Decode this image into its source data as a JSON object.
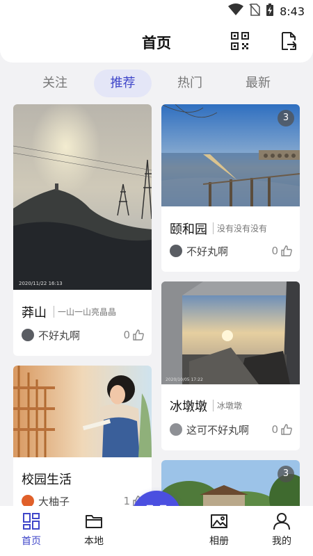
{
  "status_bar": {
    "time": "8:43",
    "icons": [
      "wifi-icon",
      "no-sim-icon",
      "battery-charging-icon"
    ]
  },
  "header": {
    "title": "首页",
    "icons": [
      "qr-code-icon",
      "share-export-icon"
    ]
  },
  "tabs": [
    {
      "label": "关注",
      "active": false
    },
    {
      "label": "推荐",
      "active": true
    },
    {
      "label": "热门",
      "active": false
    },
    {
      "label": "最新",
      "active": false
    }
  ],
  "cards": [
    {
      "title": "莽山",
      "subtitle": "一山一山亮晶晶",
      "author": "不好丸啊",
      "likes": "0",
      "photo_stamp": "2020/11/22 16:13"
    },
    {
      "title": "颐和园",
      "subtitle": "没有没有没有",
      "author": "不好丸啊",
      "likes": "0",
      "badge": "3"
    },
    {
      "title": "冰墩墩",
      "subtitle": "冰墩墩",
      "author": "这可不好丸啊",
      "likes": "0",
      "photo_stamp": "2020/10/05 17:22"
    },
    {
      "title": "校园生活",
      "subtitle": "",
      "author": "大柚子",
      "likes": "1"
    },
    {
      "title": "",
      "subtitle": "",
      "author": "",
      "likes": "",
      "badge": "3"
    }
  ],
  "bottom_nav": [
    {
      "label": "首页",
      "icon": "home-grid-icon",
      "active": true
    },
    {
      "label": "本地",
      "icon": "folder-icon",
      "active": false
    },
    {
      "label": "",
      "icon": "scan-icon",
      "active": false
    },
    {
      "label": "相册",
      "icon": "photo-album-icon",
      "active": false
    },
    {
      "label": "我的",
      "icon": "person-icon",
      "active": false
    }
  ],
  "colors": {
    "accent": "#4b4fe0",
    "active_tab_bg": "#e4e6f7",
    "background": "#f2f2f4"
  }
}
